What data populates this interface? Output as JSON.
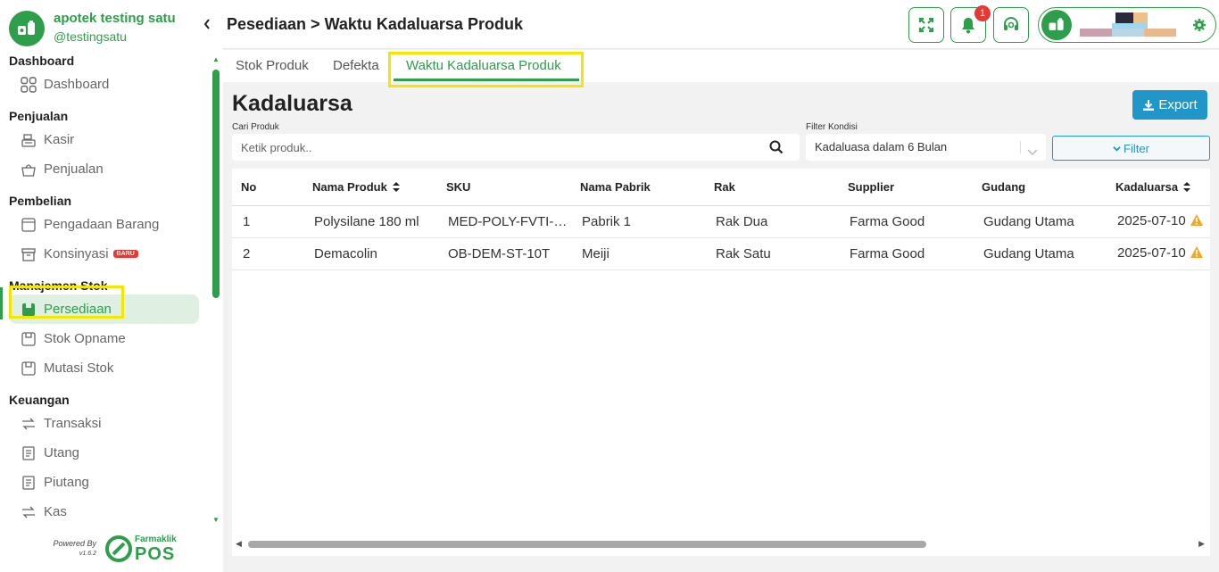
{
  "sidebar": {
    "store_name": "apotek testing satu",
    "username": "@testingsatu",
    "sections": [
      {
        "title": "Dashboard",
        "items": [
          {
            "label": "Dashboard",
            "icon": "grid-icon"
          }
        ]
      },
      {
        "title": "Penjualan",
        "items": [
          {
            "label": "Kasir",
            "icon": "cash-register-icon"
          },
          {
            "label": "Penjualan",
            "icon": "basket-icon"
          }
        ]
      },
      {
        "title": "Pembelian",
        "items": [
          {
            "label": "Pengadaan Barang",
            "icon": "document-icon"
          },
          {
            "label": "Konsinyasi",
            "icon": "archive-icon",
            "badge": "BARU"
          }
        ]
      },
      {
        "title": "Manajemen Stok",
        "items": [
          {
            "label": "Persediaan",
            "icon": "box-icon",
            "active": true
          },
          {
            "label": "Stok Opname",
            "icon": "box-icon"
          },
          {
            "label": "Mutasi Stok",
            "icon": "box-icon"
          }
        ]
      },
      {
        "title": "Keuangan",
        "items": [
          {
            "label": "Transaksi",
            "icon": "transfer-icon"
          },
          {
            "label": "Utang",
            "icon": "receipt-icon"
          },
          {
            "label": "Piutang",
            "icon": "receipt-icon"
          },
          {
            "label": "Kas",
            "icon": "transfer-icon"
          }
        ]
      }
    ],
    "powered_by": "Powered By",
    "version": "v1.6.2",
    "logo_line1": "Farmaklik",
    "logo_line2": "POS"
  },
  "header": {
    "title": "Pesediaan > Waktu Kadaluarsa Produk",
    "notification_count": "1"
  },
  "tabs": [
    {
      "label": "Stok Produk",
      "active": false
    },
    {
      "label": "Defekta",
      "active": false
    },
    {
      "label": "Waktu Kadaluarsa Produk",
      "active": true
    }
  ],
  "content": {
    "title": "Kadaluarsa",
    "export_label": "Export",
    "search_label": "Cari Produk",
    "search_placeholder": "Ketik produk..",
    "filter_label": "Filter Kondisi",
    "filter_value": "Kadaluasa dalam 6 Bulan",
    "filter_button": "Filter"
  },
  "table": {
    "columns": [
      "No",
      "Nama Produk",
      "SKU",
      "Nama Pabrik",
      "Rak",
      "Supplier",
      "Gudang",
      "Kadaluarsa"
    ],
    "rows": [
      [
        "1",
        "Polysilane 180 ml",
        "MED-POLY-FVTI-…",
        "Pabrik 1",
        "Rak Dua",
        "Farma Good",
        "Gudang Utama",
        "2025-07-10"
      ],
      [
        "2",
        "Demacolin",
        "OB-DEM-ST-10T",
        "Meiji",
        "Rak Satu",
        "Farma Good",
        "Gudang Utama",
        "2025-07-10"
      ]
    ]
  },
  "colors": {
    "brand_green": "#2e9e4a",
    "accent_blue": "#2196c9",
    "warning": "#f5a623",
    "highlight": "#f5e600"
  }
}
